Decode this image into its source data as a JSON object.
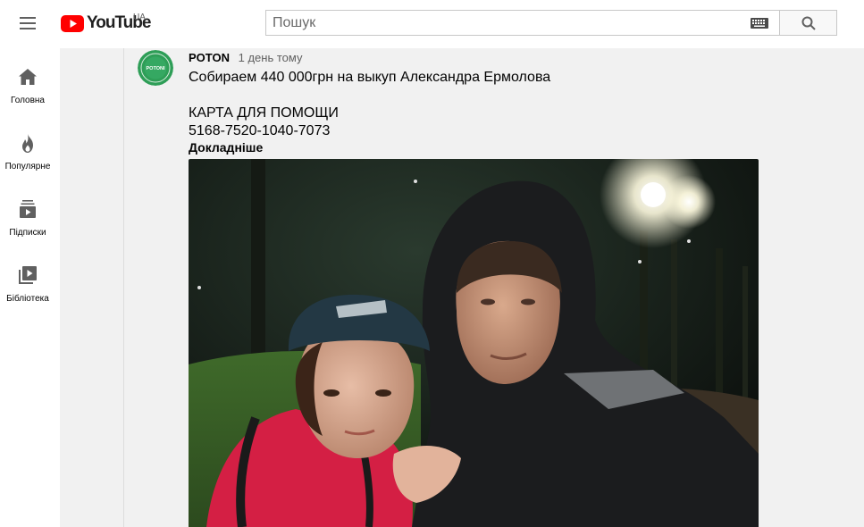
{
  "header": {
    "logo_text": "YouTube",
    "country_code": "UA",
    "search_placeholder": "Пошук",
    "brand_color": "#ff0000"
  },
  "sidenav": {
    "items": [
      {
        "label": "Головна",
        "icon": "home-icon"
      },
      {
        "label": "Популярне",
        "icon": "fire-icon"
      },
      {
        "label": "Підписки",
        "icon": "subscriptions-icon"
      },
      {
        "label": "Бібліотека",
        "icon": "library-icon"
      }
    ]
  },
  "post": {
    "author": "POTON",
    "time": "1 день тому",
    "avatar_text": "POTONI",
    "avatar_color": "#2e9e57",
    "lines": [
      "Собираем 440 000грн на выкуп Александра Ермолова",
      "КАРТА ДЛЯ ПОМОЩИ",
      "5168-7520-1040-7073"
    ],
    "more_label": "Докладніше",
    "image_icon": "post-photo"
  }
}
